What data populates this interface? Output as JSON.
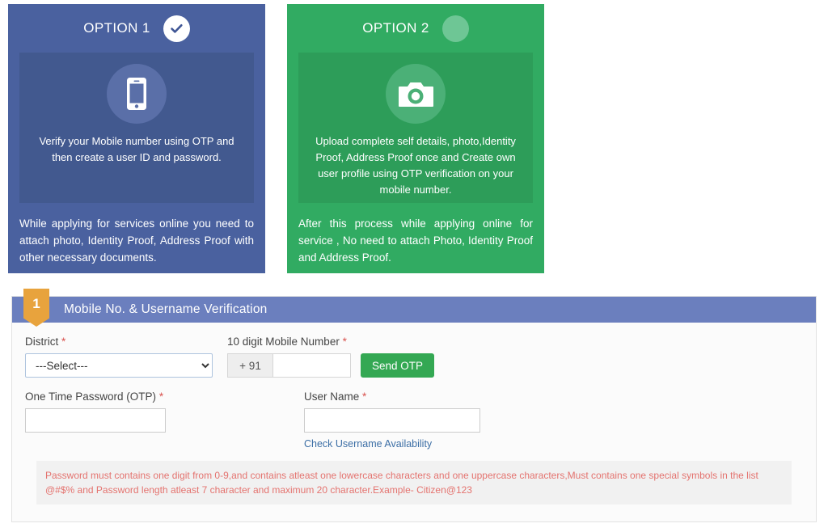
{
  "options": [
    {
      "id": "option1",
      "title": "OPTION 1",
      "selected": true,
      "icon": "mobile-phone-icon",
      "body_text": "Verify your Mobile number using OTP and then create a user ID and password.",
      "footer_text": "While applying for services online you need to attach photo, Identity Proof, Address Proof with other necessary documents.",
      "bg_color": "#4a619f",
      "inner_bg_color": "#42598f"
    },
    {
      "id": "option2",
      "title": "OPTION 2",
      "selected": false,
      "icon": "camera-icon",
      "body_text": "Upload complete self details, photo,Identity Proof, Address Proof once and Create own user profile using OTP verification on your mobile number.",
      "footer_text": "After this process while applying online for service , No need to attach Photo, Identity Proof and Address Proof.",
      "bg_color": "#31ab62",
      "inner_bg_color": "#2d9d59"
    }
  ],
  "form": {
    "step_number": "1",
    "header_title": "Mobile No. & Username Verification",
    "header_bg_color": "#6b7fbe",
    "ribbon_color": "#e8a33d",
    "required_marker": "*",
    "fields": {
      "district": {
        "label": "District",
        "required": true,
        "selected_option": "---Select---",
        "options": [
          "---Select---"
        ]
      },
      "mobile": {
        "label": "10 digit Mobile Number",
        "required": true,
        "country_prefix": "+ 91",
        "value": "",
        "placeholder": ""
      },
      "otp": {
        "label": "One Time Password (OTP)",
        "required": true,
        "value": "",
        "placeholder": ""
      },
      "username": {
        "label": "User Name",
        "required": true,
        "value": "",
        "placeholder": ""
      }
    },
    "send_otp_label": "Send OTP",
    "send_otp_color": "#34a853",
    "check_username_link": "Check Username Availability",
    "password_note": "Password must contains one digit from 0-9,and contains atleast one lowercase characters and one uppercase characters,Must contains one special symbols in the list @#$% and Password length atleast 7 character and maximum 20 character.Example- Citizen@123",
    "password_note_color": "#e4736f"
  }
}
